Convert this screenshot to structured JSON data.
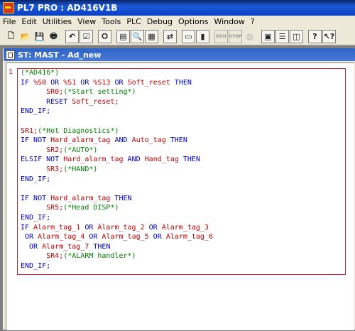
{
  "window": {
    "title": "PL7 PRO : AD416V1B"
  },
  "menu": [
    "File",
    "Edit",
    "Utilities",
    "View",
    "Tools",
    "PLC",
    "Debug",
    "Options",
    "Window",
    "?"
  ],
  "toolbar": {
    "buttons": [
      {
        "name": "new-file-icon",
        "glyph": "🗋"
      },
      {
        "name": "open-folder-icon",
        "glyph": "📂"
      },
      {
        "name": "save-icon",
        "glyph": "💾"
      },
      {
        "name": "print-icon",
        "glyph": "🖶"
      },
      {
        "sep": true
      },
      {
        "name": "undo-icon",
        "glyph": "↶"
      },
      {
        "name": "validate-icon",
        "glyph": "☑"
      },
      {
        "sep": true
      },
      {
        "name": "analyze-icon",
        "glyph": "⛭"
      },
      {
        "sep": true
      },
      {
        "name": "browser-icon",
        "glyph": "▤"
      },
      {
        "name": "find-icon",
        "glyph": "🔍"
      },
      {
        "name": "library-icon",
        "glyph": "▦"
      },
      {
        "sep": true
      },
      {
        "name": "transfer-icon",
        "glyph": "⇄"
      },
      {
        "sep": true
      },
      {
        "name": "connect-icon",
        "glyph": "▭"
      },
      {
        "name": "monitor-icon",
        "glyph": "▮"
      },
      {
        "sep": true
      },
      {
        "name": "run-icon",
        "glyph": "RUN",
        "disabled": true
      },
      {
        "name": "stop-icon",
        "glyph": "STOP",
        "disabled": true
      },
      {
        "name": "init-icon",
        "glyph": "◎",
        "disabled": true
      },
      {
        "sep": true
      },
      {
        "name": "cascade-windows-icon",
        "glyph": "▣"
      },
      {
        "name": "tile-horizontal-icon",
        "glyph": "☰"
      },
      {
        "name": "tile-vertical-icon",
        "glyph": "◫"
      },
      {
        "sep": true
      },
      {
        "name": "help-icon",
        "glyph": "?"
      },
      {
        "name": "context-help-icon",
        "glyph": "↖?"
      }
    ]
  },
  "document": {
    "title": "ST: MAST - Ad_new",
    "gutter_marker": "1"
  },
  "code_lines": [
    [
      {
        "t": "(*AD416*)",
        "c": "cm"
      }
    ],
    [
      {
        "t": "IF ",
        "c": "kw"
      },
      {
        "t": "%S0",
        "c": "var"
      },
      {
        "t": " OR ",
        "c": "kw"
      },
      {
        "t": "%S1",
        "c": "var"
      },
      {
        "t": " OR ",
        "c": "kw"
      },
      {
        "t": "%S13",
        "c": "var"
      },
      {
        "t": " OR ",
        "c": "kw"
      },
      {
        "t": "Soft_reset",
        "c": "var"
      },
      {
        "t": " THEN",
        "c": "kw"
      }
    ],
    [
      {
        "t": "      "
      },
      {
        "t": "SR0;",
        "c": "var"
      },
      {
        "t": "(*Start setting*)",
        "c": "cm"
      }
    ],
    [
      {
        "t": "      "
      },
      {
        "t": "RESET ",
        "c": "kw"
      },
      {
        "t": "Soft_reset;",
        "c": "var"
      }
    ],
    [
      {
        "t": "END_IF;",
        "c": "kw"
      }
    ],
    [],
    [
      {
        "t": "SR1;",
        "c": "var"
      },
      {
        "t": "(*Hot Diagnostics*)",
        "c": "cm"
      }
    ],
    [
      {
        "t": "IF NOT ",
        "c": "kw"
      },
      {
        "t": "Hard_alarm_tag",
        "c": "var"
      },
      {
        "t": " AND ",
        "c": "kw"
      },
      {
        "t": "Auto_tag",
        "c": "var"
      },
      {
        "t": " THEN",
        "c": "kw"
      }
    ],
    [
      {
        "t": "      "
      },
      {
        "t": "SR2;",
        "c": "var"
      },
      {
        "t": "(*AUTO*)",
        "c": "cm"
      }
    ],
    [
      {
        "t": "ELSIF NOT ",
        "c": "kw"
      },
      {
        "t": "Hard_alarm_tag",
        "c": "var"
      },
      {
        "t": " AND ",
        "c": "kw"
      },
      {
        "t": "Hand_tag",
        "c": "var"
      },
      {
        "t": " THEN",
        "c": "kw"
      }
    ],
    [
      {
        "t": "      "
      },
      {
        "t": "SR3;",
        "c": "var"
      },
      {
        "t": "(*HAND*)",
        "c": "cm"
      }
    ],
    [
      {
        "t": "END_IF;",
        "c": "kw"
      }
    ],
    [],
    [
      {
        "t": "IF NOT ",
        "c": "kw"
      },
      {
        "t": "Hard_alarm_tag",
        "c": "var"
      },
      {
        "t": " THEN",
        "c": "kw"
      }
    ],
    [
      {
        "t": "      "
      },
      {
        "t": "SR5;",
        "c": "var"
      },
      {
        "t": "(*Head DISP*)",
        "c": "cm"
      }
    ],
    [
      {
        "t": "END_IF;",
        "c": "kw"
      }
    ],
    [
      {
        "t": "IF ",
        "c": "kw"
      },
      {
        "t": "Alarm_tag_1",
        "c": "var"
      },
      {
        "t": " OR ",
        "c": "kw"
      },
      {
        "t": "Alarm_tag_2",
        "c": "var"
      },
      {
        "t": " OR ",
        "c": "kw"
      },
      {
        "t": "Alarm_tag_3",
        "c": "var"
      }
    ],
    [
      {
        "t": " OR ",
        "c": "kw"
      },
      {
        "t": "Alarm_tag_4",
        "c": "var"
      },
      {
        "t": " OR ",
        "c": "kw"
      },
      {
        "t": "Alarm_tag_5",
        "c": "var"
      },
      {
        "t": " OR ",
        "c": "kw"
      },
      {
        "t": "Alarm_tag_6",
        "c": "var"
      }
    ],
    [
      {
        "t": "  OR ",
        "c": "kw"
      },
      {
        "t": "Alarm_tag_7",
        "c": "var"
      },
      {
        "t": " THEN",
        "c": "kw"
      }
    ],
    [
      {
        "t": "      "
      },
      {
        "t": "SR4;",
        "c": "var"
      },
      {
        "t": "(*ALARM handler*)",
        "c": "cm"
      }
    ],
    [
      {
        "t": "END_IF;",
        "c": "kw"
      }
    ]
  ],
  "colors": {
    "keyword": "#0000c0",
    "variable": "#c00000",
    "comment": "#008000",
    "frame": "#d3202e",
    "title_bar": "#0a3fc4"
  }
}
